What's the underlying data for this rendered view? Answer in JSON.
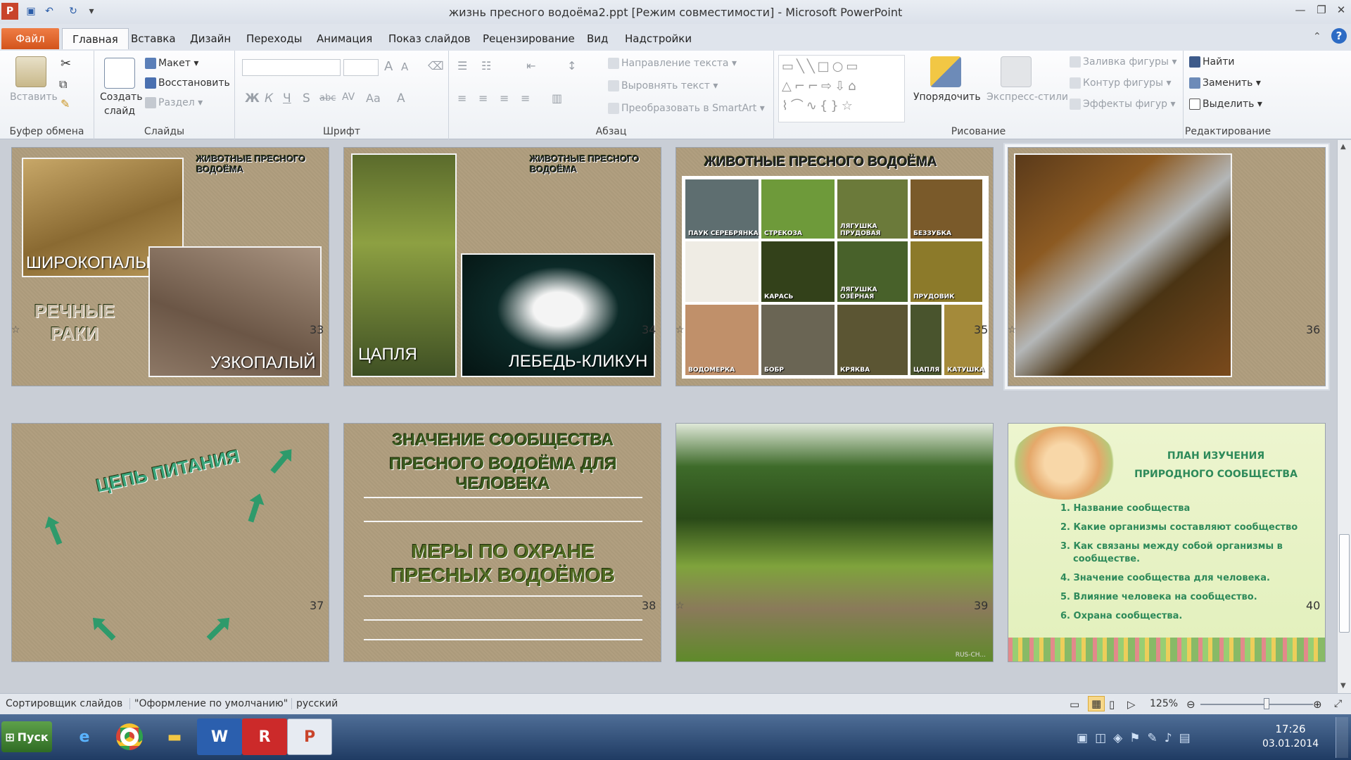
{
  "window": {
    "title": "жизнь пресного водоёма2.ppt [Режим совместимости] - Microsoft PowerPoint"
  },
  "tabs": [
    "Файл",
    "Главная",
    "Вставка",
    "Дизайн",
    "Переходы",
    "Анимация",
    "Показ слайдов",
    "Рецензирование",
    "Вид",
    "Надстройки"
  ],
  "ribbon": {
    "clipboard": {
      "paste": "Вставить",
      "label": "Буфер обмена"
    },
    "slides": {
      "create": "Создать",
      "create2": "слайд",
      "layout": "Макет",
      "reset": "Восстановить",
      "section": "Раздел",
      "label": "Слайды"
    },
    "font": {
      "label": "Шрифт"
    },
    "paragraph": {
      "text_dir": "Направление текста",
      "align_text": "Выровнять текст",
      "smartart": "Преобразовать в SmartArt",
      "label": "Абзац"
    },
    "drawing": {
      "arrange": "Упорядочить",
      "quick_styles": "Экспресс-стили",
      "fill": "Заливка фигуры",
      "outline": "Контур фигуры",
      "effects": "Эффекты фигур",
      "label": "Рисование"
    },
    "editing": {
      "find": "Найти",
      "replace": "Заменить",
      "select": "Выделить",
      "label": "Редактирование"
    }
  },
  "slides": [
    {
      "num": "33",
      "title": "ЖИВОТНЫЕ ПРЕСНОГО ВОДОЁМА",
      "label1": "ШИРОКОПАЛЫЙ",
      "label2": "УЗКОПАЛЫЙ",
      "caption": "РЕЧНЫЕ РАКИ"
    },
    {
      "num": "34",
      "title": "ЖИВОТНЫЕ ПРЕСНОГО ВОДОЁМА",
      "label1": "ЦАПЛЯ",
      "label2": "ЛЕБЕДЬ-КЛИКУН"
    },
    {
      "num": "35",
      "title": "ЖИВОТНЫЕ ПРЕСНОГО ВОДОЁМА",
      "cells": [
        "ПАУК СЕРЕБРЯНКА",
        "СТРЕКОЗА",
        "ЛЯГУШКА ПРУДОВАЯ",
        "БЕЗЗУБКА",
        "",
        "КАРАСЬ",
        "ЛЯГУШКА ОЗЁРНАЯ",
        "ПРУДОВИК",
        "ВОДОМЕРКА",
        "БОБР",
        "КРЯКВА",
        "ЦАПЛЯ",
        "КАТУШКА"
      ]
    },
    {
      "num": "36"
    },
    {
      "num": "37",
      "title": "ЦЕПЬ ПИТАНИЯ"
    },
    {
      "num": "38",
      "title1": "ЗНАЧЕНИЕ СООБЩЕСТВА",
      "title2": "ПРЕСНОГО ВОДОЁМА ДЛЯ ЧЕЛОВЕКА",
      "sub1": "МЕРЫ ПО ОХРАНЕ",
      "sub2": "ПРЕСНЫХ ВОДОЁМОВ"
    },
    {
      "num": "39",
      "watermark": "RUS-CH..."
    },
    {
      "num": "40",
      "heading1": "ПЛАН ИЗУЧЕНИЯ",
      "heading2": "ПРИРОДНОГО СООБЩЕСТВА",
      "items": [
        "Название сообщества",
        "Какие организмы составляют  сообщество",
        "Как связаны между собой организмы  в сообществе.",
        "Значение сообщества  для человека.",
        "Влияние человека на сообщество.",
        "Охрана сообщества."
      ]
    }
  ],
  "status": {
    "view": "Сортировщик слайдов",
    "theme": "\"Оформление по умолчанию\"",
    "lang": "русский",
    "zoom": "125%"
  },
  "taskbar": {
    "start": "Пуск",
    "time": "17:26",
    "date": "03.01.2014"
  },
  "colors": {
    "file_tab": "#d95e27",
    "accent_green": "#2e9a6b",
    "title_green": "#3b5a1e"
  }
}
